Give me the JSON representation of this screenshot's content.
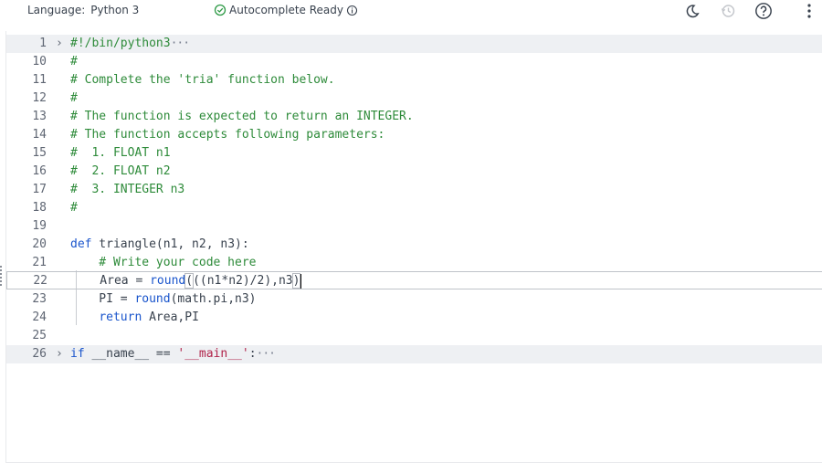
{
  "toolbar": {
    "language_label": "Language:",
    "language_value": "Python 3",
    "autocomplete_label": "Autocomplete Ready",
    "icons": [
      "theme-moon-icon",
      "history-icon",
      "help-icon",
      "more-options-icon"
    ]
  },
  "editor": {
    "lines": [
      {
        "num": "1",
        "parts": [
          "#!/bin/python3"
        ]
      },
      {
        "num": "10",
        "parts": [
          "#"
        ]
      },
      {
        "num": "11",
        "parts": [
          "# Complete the 'tria' function below."
        ]
      },
      {
        "num": "12",
        "parts": [
          "#"
        ]
      },
      {
        "num": "13",
        "parts": [
          "# The function is expected to return an INTEGER."
        ]
      },
      {
        "num": "14",
        "parts": [
          "# The function accepts following parameters:"
        ]
      },
      {
        "num": "15",
        "parts": [
          "#  1. FLOAT n1"
        ]
      },
      {
        "num": "16",
        "parts": [
          "#  2. FLOAT n2"
        ]
      },
      {
        "num": "17",
        "parts": [
          "#  3. INTEGER n3"
        ]
      },
      {
        "num": "18",
        "parts": [
          "#"
        ]
      },
      {
        "num": "19",
        "parts": [
          ""
        ]
      },
      {
        "num": "20",
        "parts": [
          "def",
          " triangle(n1, n2, n3):"
        ]
      },
      {
        "num": "21",
        "parts": [
          "    # Write your code here"
        ]
      },
      {
        "num": "22",
        "parts": [
          "    Area = ",
          "round",
          "(",
          "((n1*n2)/2),n3",
          ")"
        ]
      },
      {
        "num": "23",
        "parts": [
          "    PI = ",
          "round",
          "(math.pi,n3)"
        ]
      },
      {
        "num": "24",
        "parts": [
          "    ",
          "return",
          " Area,PI"
        ]
      },
      {
        "num": "25",
        "parts": [
          ""
        ]
      },
      {
        "num": "26",
        "parts": [
          "if",
          " __name__ == ",
          "'__main__'",
          ":"
        ]
      }
    ],
    "fold_marker": "›",
    "ellipsis": "···"
  }
}
